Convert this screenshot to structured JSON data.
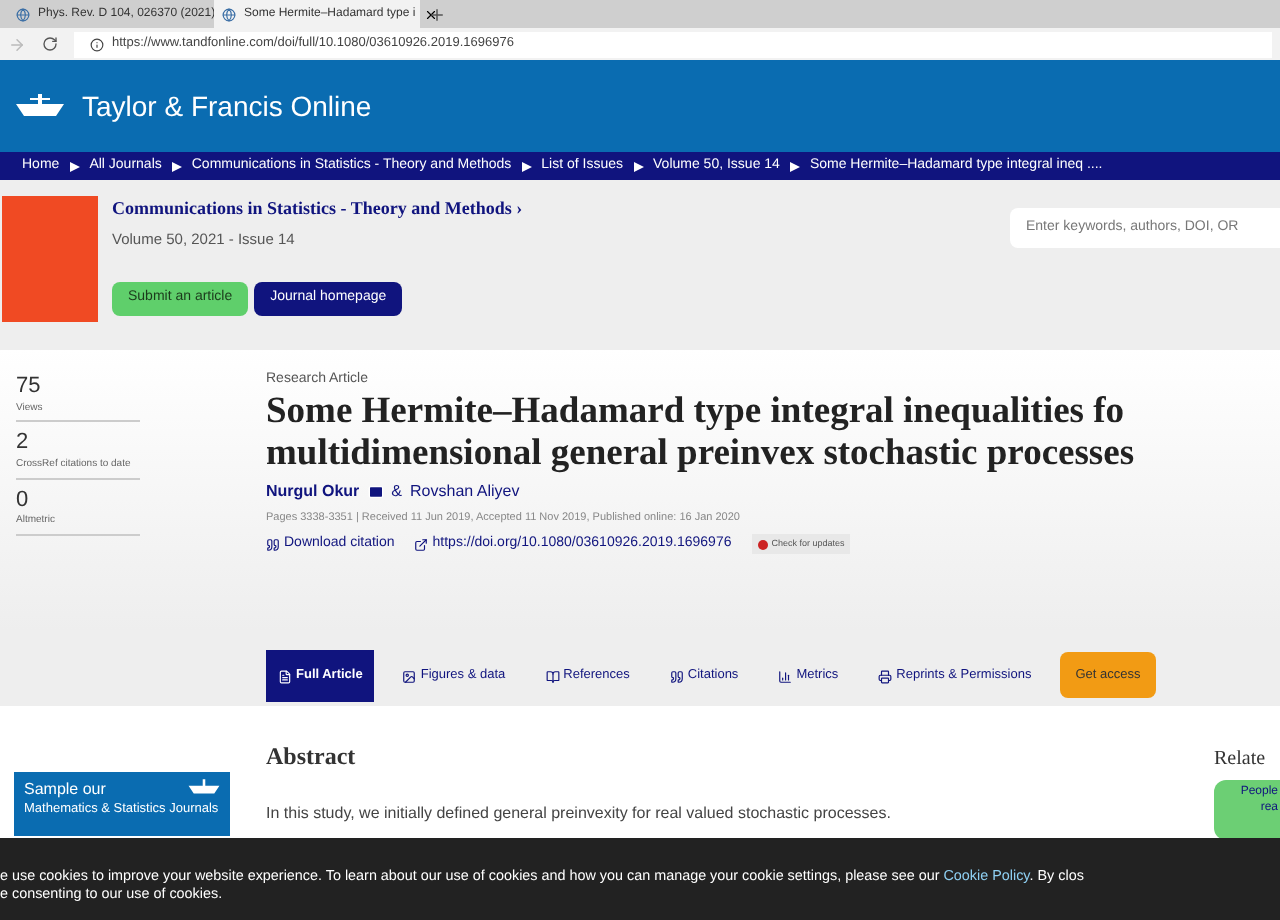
{
  "browser": {
    "tabs": [
      {
        "title": "Phys. Rev. D 104, 026370 (2021)",
        "selected": false
      },
      {
        "title": "Some Hermite–Hadamard type i",
        "selected": true
      }
    ],
    "url": "https://www.tandfonline.com/doi/full/10.1080/03610926.2019.1696976"
  },
  "site": {
    "logo_text": "Taylor & Francis Online"
  },
  "breadcrumb": [
    "Home",
    "All Journals",
    "Communications in Statistics - Theory and Methods",
    "List of Issues",
    "Volume 50, Issue 14",
    "Some Hermite–Hadamard type integral ineq ...."
  ],
  "journal": {
    "title": "Communications in Statistics - Theory and Methods ›",
    "issue": "Volume 50, 2021 - Issue 14",
    "buttons": [
      {
        "label": "Submit an article",
        "kind": "green"
      },
      {
        "label": "Journal homepage",
        "kind": "navy"
      }
    ],
    "search": {
      "placeholder": "Enter keywords, authors, DOI, OR"
    }
  },
  "metrics": [
    {
      "value": "75",
      "label": "Views"
    },
    {
      "value": "2",
      "label": "CrossRef citations to date"
    },
    {
      "value": "0",
      "label": "Altmetric"
    }
  ],
  "article": {
    "type": "Research Article",
    "title": "Some Hermite–Hadamard type integral inequalities fo multidimensional general preinvex stochastic processes",
    "authors": [
      {
        "name": "Nurgul Okur",
        "email": true
      },
      {
        "name": "Rovshan Aliyev",
        "email": false
      }
    ],
    "author_separator": "&",
    "meta": "Pages 3338-3351 | Received 11 Jun 2019, Accepted 11 Nov 2019, Published online: 16 Jan 2020",
    "links": [
      {
        "kind": "citation",
        "label": "Download citation"
      },
      {
        "kind": "doi",
        "label": "https://doi.org/10.1080/03610926.2019.1696976"
      }
    ],
    "check_updates": "Check for updates"
  },
  "article_tabs": [
    {
      "label": "Full Article",
      "kind": "file",
      "selected": true
    },
    {
      "label": "Figures & data",
      "kind": "image",
      "selected": false
    },
    {
      "label": "References",
      "kind": "book",
      "selected": false
    },
    {
      "label": "Citations",
      "kind": "quote",
      "selected": false
    },
    {
      "label": "Metrics",
      "kind": "chart",
      "selected": false
    },
    {
      "label": "Reprints & Permissions",
      "kind": "print",
      "selected": false
    }
  ],
  "get_access": "Get access",
  "promo": {
    "title": "Sample our",
    "subtitle": "Mathematics & Statistics Journals"
  },
  "abstract": {
    "heading": "Abstract",
    "text": "In this study, we initially defined general preinvexity for real valued stochastic processes."
  },
  "related": {
    "heading": "Relate",
    "card_lines": [
      "People",
      "rea"
    ]
  },
  "cookie": {
    "before": "e use cookies to improve your website experience. To learn about our use of cookies and how you can manage your cookie settings, please see our ",
    "link": "Cookie Policy",
    "after": ". By clos",
    "line2": "e consenting to our use of cookies."
  }
}
